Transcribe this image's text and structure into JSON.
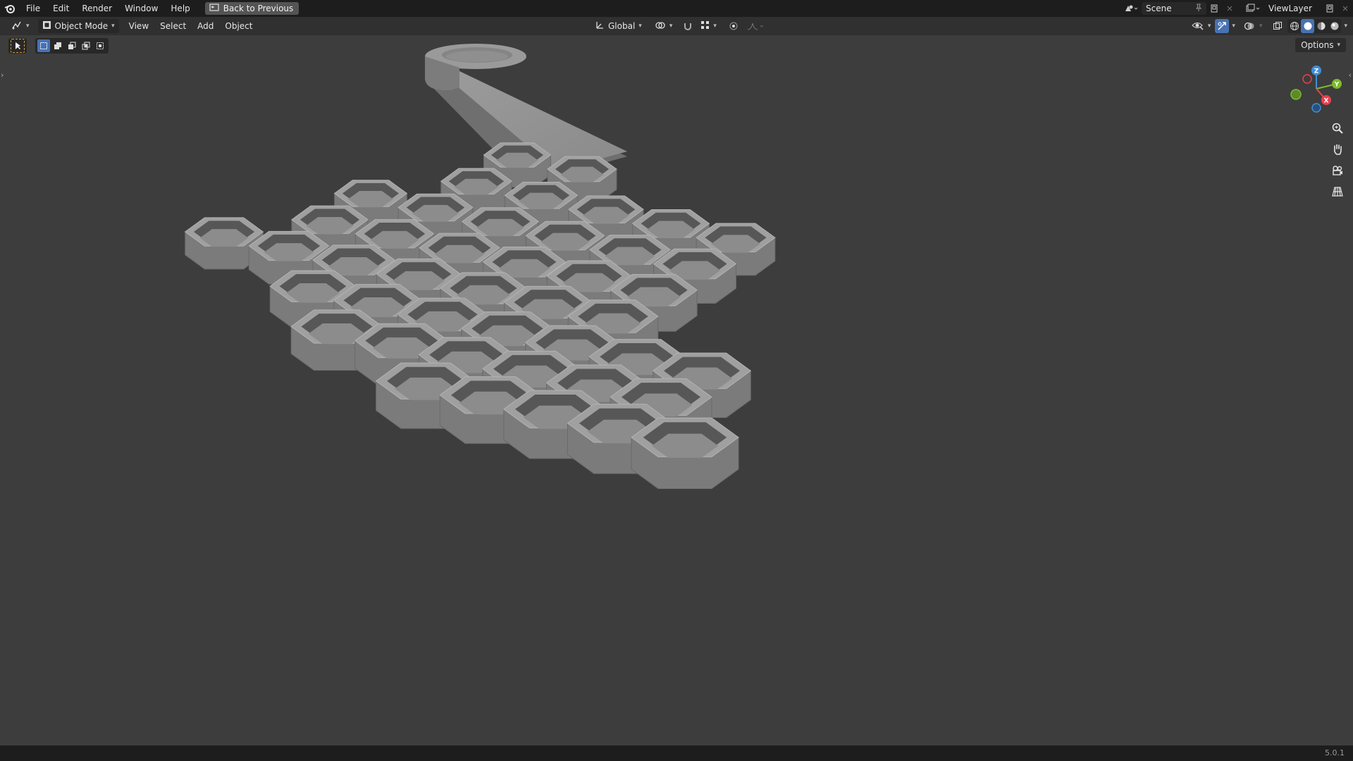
{
  "topbar": {
    "menus": [
      "File",
      "Edit",
      "Render",
      "Window",
      "Help"
    ],
    "back_button": "Back to Previous",
    "scene": "Scene",
    "view_layer": "ViewLayer"
  },
  "header": {
    "mode": "Object Mode",
    "menus": [
      "View",
      "Select",
      "Add",
      "Object"
    ],
    "orientation": "Global"
  },
  "viewport": {
    "options_label": "Options"
  },
  "gizmo": {
    "z": "Z",
    "y": "Y",
    "x": "X"
  },
  "status": {
    "version": "5.0.1"
  },
  "colors": {
    "topbar_bg": "#1d1d1d",
    "header_bg": "#303030",
    "viewport_bg": "#3d3d3d",
    "active_blue": "#4772b3",
    "axis_x": "#e8414f",
    "axis_y": "#7dbb2b",
    "axis_z": "#3f8fd8"
  }
}
